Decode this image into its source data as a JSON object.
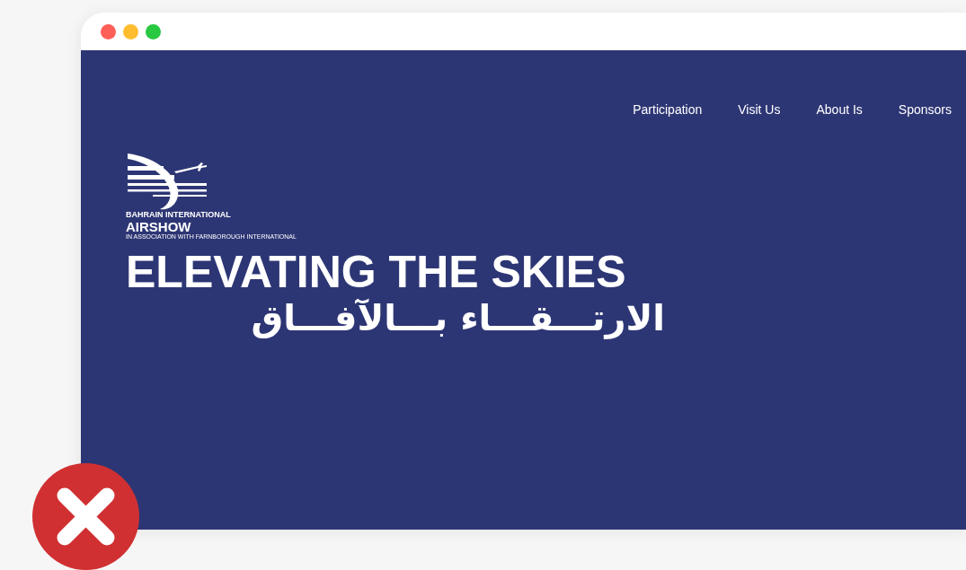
{
  "nav": [
    {
      "label": "Participation"
    },
    {
      "label": "Visit Us"
    },
    {
      "label": "About Is"
    },
    {
      "label": "Sponsors"
    }
  ],
  "logo": {
    "line_1": "BAHRAIN INTERNATIONAL",
    "line_2": "AIRSHOW",
    "line_3": "IN ASSOCIATION WITH FARNBOROUGH INTERNATIONAL"
  },
  "hero": {
    "title": "ELEVATING THE SKIES",
    "title_arabic": "الارتـــقـــاء بـــالآفـــاق"
  }
}
